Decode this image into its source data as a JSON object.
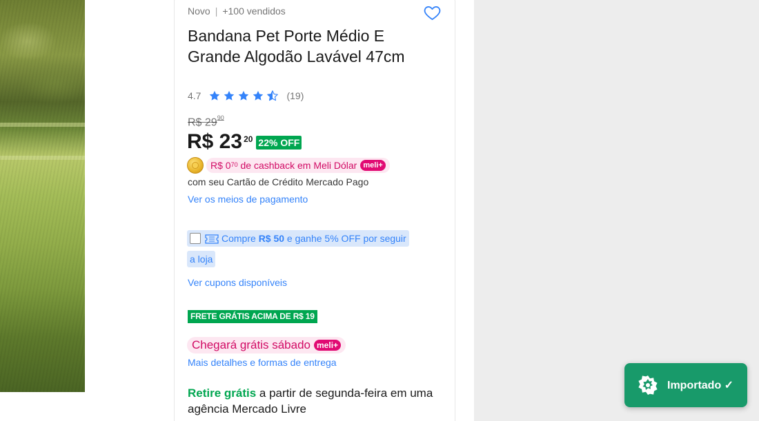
{
  "product": {
    "condition": "Novo",
    "sold": "+100 vendidos",
    "title": "Bandana Pet Porte Médio E Grande Algodão Lavável 47cm",
    "rating": {
      "value": "4.7",
      "reviews": "(19)",
      "stars": 4.5
    }
  },
  "price": {
    "old_int": "R$ 29",
    "old_cents": "90",
    "current_int": "R$ 23",
    "current_cents": "20",
    "discount": "22% OFF"
  },
  "cashback": {
    "prefix": "R$ 0",
    "cents": "70",
    "suffix": " de cashback em Meli Dólar",
    "badge": "meli+",
    "sub": "com seu Cartão de Crédito Mercado Pago",
    "payment_link": "Ver os meios de pagamento"
  },
  "coupon": {
    "part1": "Compre ",
    "amount": "R$ 50",
    "part2": " e ganhe 5% OFF por seguir",
    "part3": "a loja",
    "link": "Ver cupons disponíveis"
  },
  "shipping": {
    "badge": "FRETE GRÁTIS ACIMA DE R$ 19",
    "arrival": "Chegará grátis sábado",
    "arrival_badge": "meli+",
    "details_link": "Mais detalhes e formas de entrega"
  },
  "pickup": {
    "highlight": "Retire grátis",
    "text": " a partir de segunda-feira em uma agência Mercado Livre"
  },
  "imported_button": {
    "label": "Importado ✓"
  },
  "icons": {
    "heart": "heart-icon",
    "star": "star-icon",
    "coin": "meli-dolar-coin-icon",
    "ticket": "ticket-icon",
    "imported": "badge-icon"
  },
  "colors": {
    "link": "#3483fa",
    "green": "#00a650",
    "pink": "#d10a64",
    "imported_bg": "#189a6a"
  }
}
